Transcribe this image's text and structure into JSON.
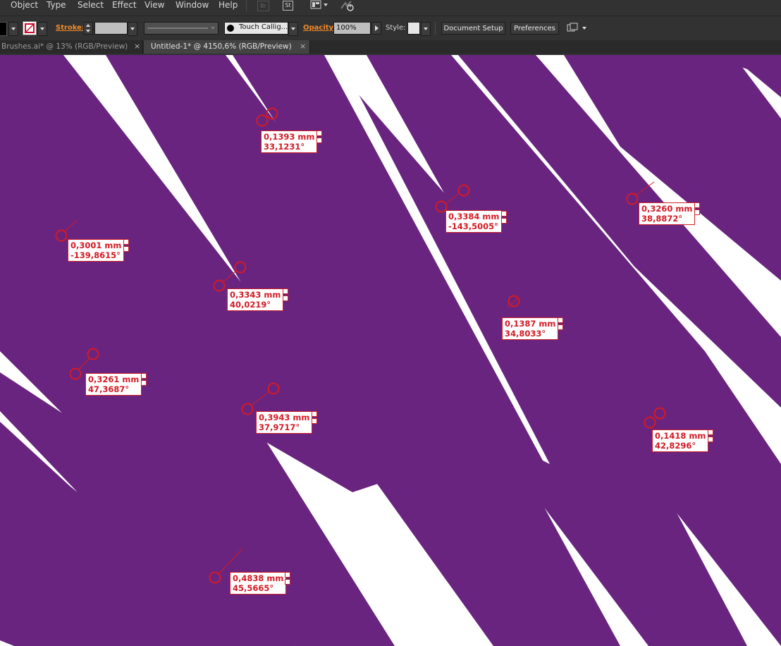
{
  "menubar": {
    "items": [
      "Object",
      "Type",
      "Select",
      "Effect",
      "View",
      "Window",
      "Help"
    ],
    "icons": {
      "bridge": "Br",
      "stock": "St"
    }
  },
  "controlbar": {
    "stroke_label": "Stroke:",
    "brush_name": "Touch Callig...",
    "opacity_label": "Opacity:",
    "opacity_value": "100%",
    "style_label": "Style:",
    "document_setup": "Document Setup",
    "preferences": "Preferences"
  },
  "tabs": [
    {
      "title": "Brushes.ai* @ 13% (RGB/Preview)",
      "close": "×",
      "active": false
    },
    {
      "title": "Untitled-1* @ 4150,6% (RGB/Preview)",
      "close": "×",
      "active": true
    }
  ],
  "canvas": {
    "stripe_color": "#69247f",
    "background": "#ffffff",
    "annotation_color": "#d41a24"
  },
  "measurements": [
    {
      "width": "0,1393 mm",
      "angle": "33,1231°"
    },
    {
      "width": "0,3001 mm",
      "angle": "-139,8615°"
    },
    {
      "width": "0,3384 mm",
      "angle": "-143,5005°"
    },
    {
      "width": "0,3260 mm",
      "angle": "38,8872°"
    },
    {
      "width": "0,3343 mm",
      "angle": "40,0219°"
    },
    {
      "width": "0,1387 mm",
      "angle": "34,8033°"
    },
    {
      "width": "0,3261 mm",
      "angle": "47,3687°"
    },
    {
      "width": "0,3943 mm",
      "angle": "37,9717°"
    },
    {
      "width": "0,1418 mm",
      "angle": "42,8296°"
    },
    {
      "width": "0,4838 mm",
      "angle": "45,5665°"
    }
  ]
}
